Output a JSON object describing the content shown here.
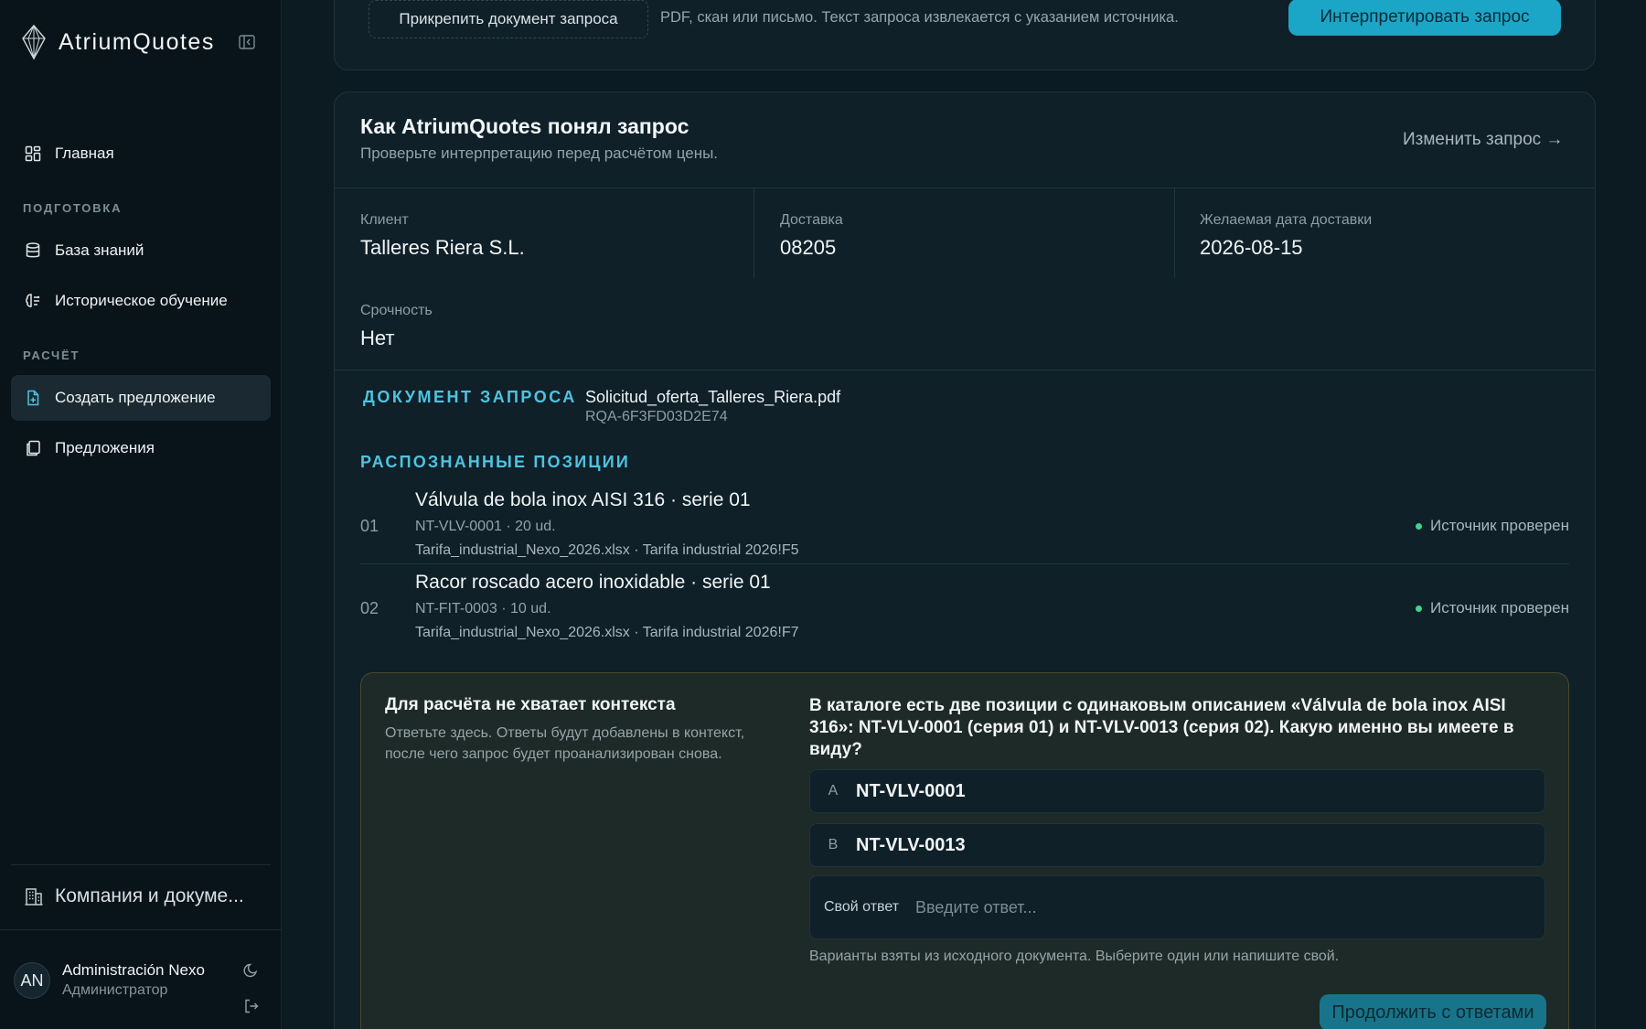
{
  "brand": {
    "name": "AtriumQuotes"
  },
  "sidebar": {
    "home": "Главная",
    "section_prep": "ПОДГОТОВКА",
    "knowledge": "База знаний",
    "history": "Историческое обучение",
    "section_calc": "РАСЧЁТ",
    "create": "Создать предложение",
    "quotes": "Предложения",
    "company": "Компания и докуме...",
    "user": {
      "initials": "AN",
      "name": "Administración Nexo",
      "role": "Администратор"
    }
  },
  "upload": {
    "attach_label": "Прикрепить документ запроса",
    "hint": "PDF, скан или письмо. Текст запроса извлекается с указанием источника.",
    "interpret_label": "Интерпретировать запрос"
  },
  "interpretation": {
    "title": "Как AtriumQuotes понял запрос",
    "subtitle": "Проверьте интерпретацию перед расчётом цены.",
    "edit_link": "Изменить запрос →",
    "fields": {
      "client_label": "Клиент",
      "client_value": "Talleres Riera S.L.",
      "delivery_label": "Доставка",
      "delivery_value": "08205",
      "date_label": "Желаемая дата доставки",
      "date_value": "2026-08-15",
      "urgency_label": "Срочность",
      "urgency_value": "Нет"
    },
    "document": {
      "label": "ДОКУМЕНТ ЗАПРОСА",
      "name": "Solicitud_oferta_Talleres_Riera.pdf",
      "id": "RQA-6F3FD03D2E74"
    },
    "items_label": "РАСПОЗНАННЫЕ ПОЗИЦИИ",
    "items": [
      {
        "num": "01",
        "title": "Válvula de bola inox AISI 316 · serie 01",
        "code": "NT-VLV-0001 · 20 ud.",
        "source": "Tarifa_industrial_Nexo_2026.xlsx · Tarifa industrial 2026!F5",
        "status": "Источник проверен"
      },
      {
        "num": "02",
        "title": "Racor roscado acero inoxidable · serie 01",
        "code": "NT-FIT-0003 · 10 ud.",
        "source": "Tarifa_industrial_Nexo_2026.xlsx · Tarifa industrial 2026!F7",
        "status": "Источник проверен"
      }
    ]
  },
  "question": {
    "left_title": "Для расчёта не хватает контекста",
    "left_subtitle": "Ответьте здесь. Ответы будут добавлены в контекст, после чего запрос будет проанализирован снова.",
    "text": "В каталоге есть две позиции с одинаковым описанием «Válvula de bola inox AISI 316»: NT-VLV-0001 (серия 01) и NT-VLV-0013 (серия 02). Какую именно вы имеете в виду?",
    "options": [
      {
        "letter": "A",
        "value": "NT-VLV-0001"
      },
      {
        "letter": "B",
        "value": "NT-VLV-0013"
      }
    ],
    "own_label": "Свой ответ",
    "own_placeholder": "Введите ответ...",
    "hint": "Варианты взяты из исходного документа. Выберите один или напишите свой.",
    "continue_label": "Продолжить с ответами"
  },
  "colors": {
    "accent": "#1ba6c8",
    "section_label": "#4fc3e0",
    "status_ok": "#3dd68c",
    "background": "#0c1a22"
  }
}
